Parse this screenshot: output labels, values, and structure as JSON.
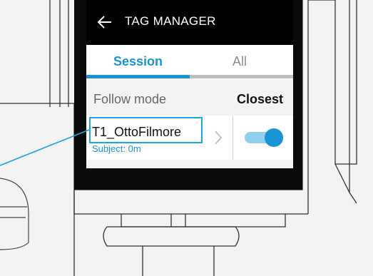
{
  "header": {
    "title": "TAG MANAGER",
    "back_icon": "arrow-left-icon"
  },
  "tabs": [
    {
      "label": "Session",
      "active": true
    },
    {
      "label": "All",
      "active": false
    }
  ],
  "follow_mode": {
    "label": "Follow mode",
    "value": "Closest"
  },
  "tag": {
    "name": "T1_OttoFilmore",
    "subject": "Subject: 0m",
    "enabled": true
  },
  "colors": {
    "accent": "#1a93d2",
    "toggle_track": "#8fd0ef",
    "highlight": "#1aa6e0"
  }
}
